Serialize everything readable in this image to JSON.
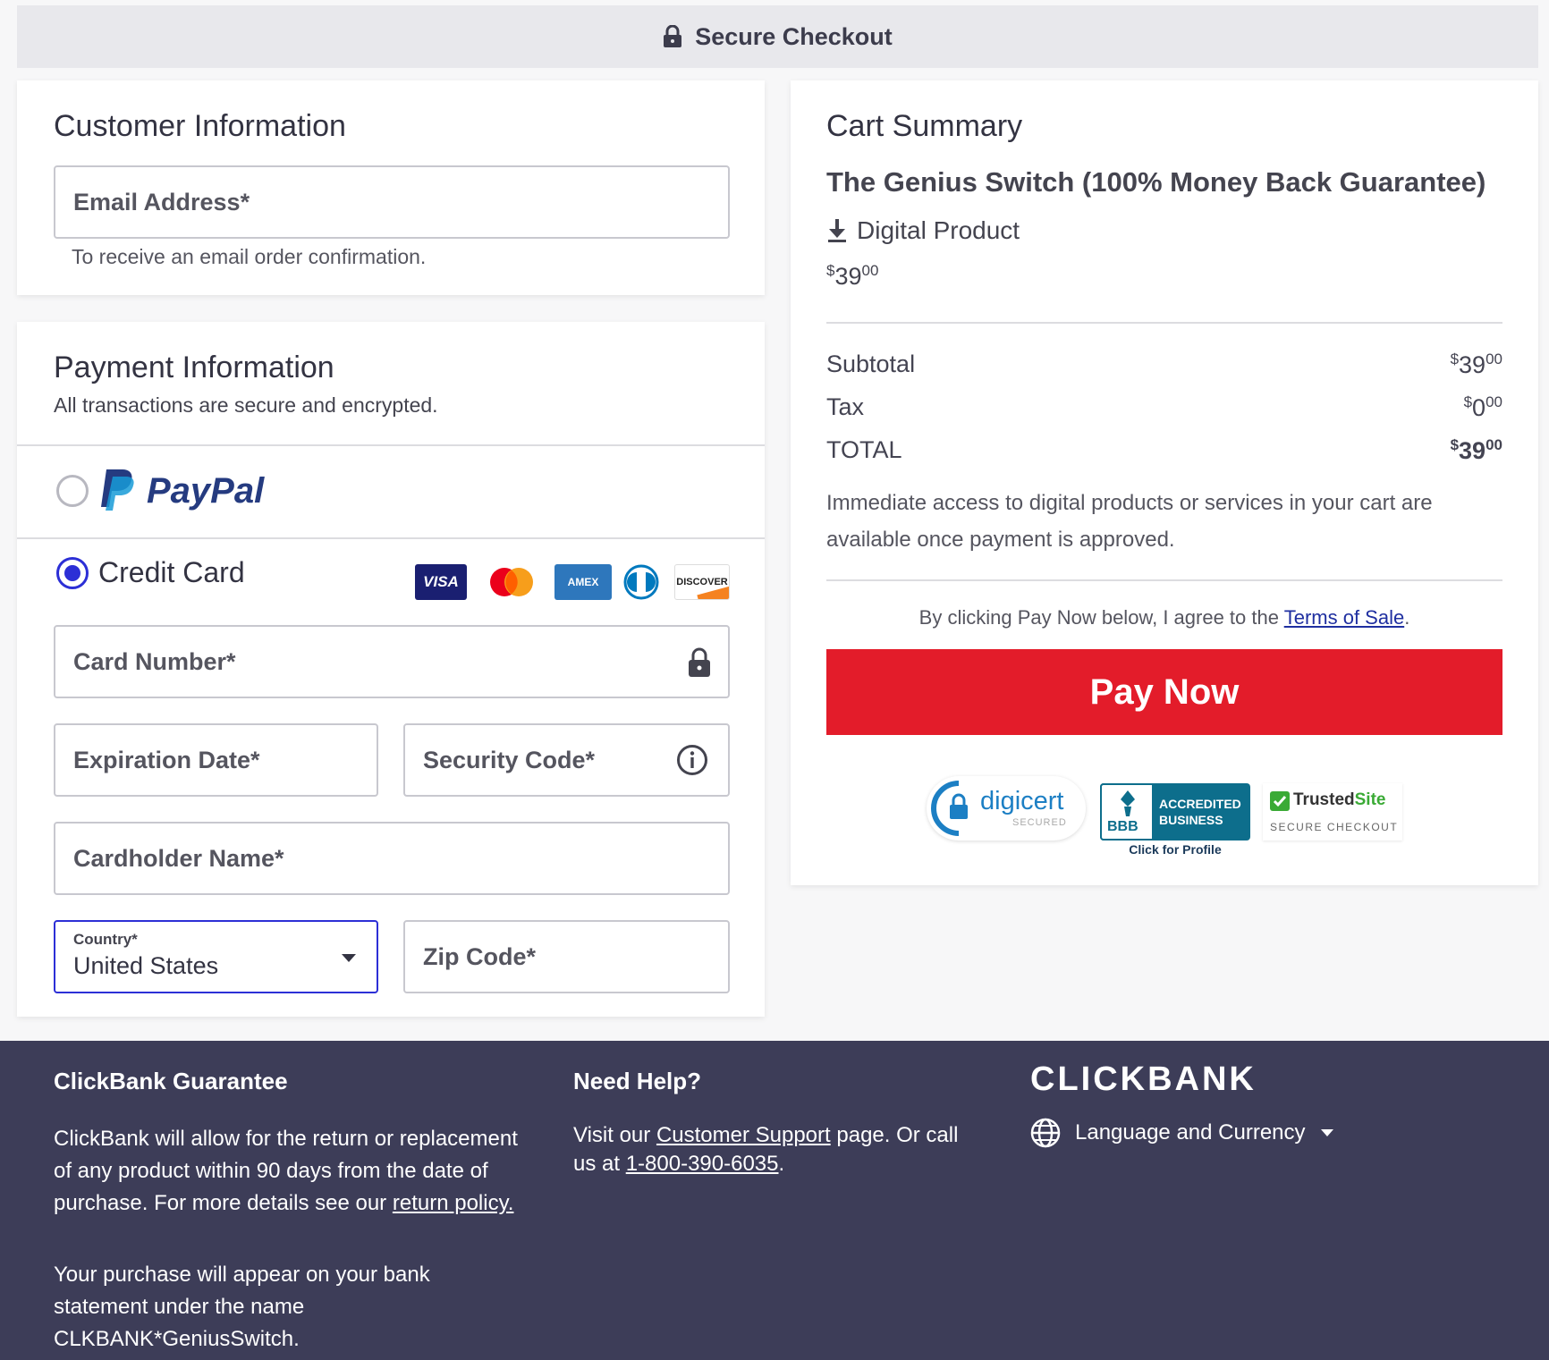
{
  "header": {
    "title": "Secure Checkout"
  },
  "customer": {
    "title": "Customer Information",
    "email_placeholder": "Email Address*",
    "email_hint": "To receive an email order confirmation."
  },
  "payment": {
    "title": "Payment Information",
    "subtitle": "All transactions are secure and encrypted.",
    "paypal_label": "PayPal",
    "credit_card_label": "Credit Card",
    "card_logos": [
      "VISA",
      "Mastercard",
      "AMEX",
      "Diners Club",
      "DISCOVER"
    ],
    "card_number_placeholder": "Card Number*",
    "expiration_placeholder": "Expiration Date*",
    "security_code_placeholder": "Security Code*",
    "cardholder_placeholder": "Cardholder Name*",
    "country_label": "Country*",
    "country_value": "United States",
    "zip_placeholder": "Zip Code*",
    "selected_method": "Credit Card"
  },
  "cart": {
    "title": "Cart Summary",
    "product_name": "The Genius Switch (100% Money Back Guarantee)",
    "product_type": "Digital Product",
    "product_price_dollars": "39",
    "product_price_cents": "00",
    "subtotal_label": "Subtotal",
    "subtotal_dollars": "39",
    "subtotal_cents": "00",
    "tax_label": "Tax",
    "tax_dollars": "0",
    "tax_cents": "00",
    "total_label": "TOTAL",
    "total_dollars": "39",
    "total_cents": "00",
    "currency_symbol": "$",
    "access_note": "Immediate access to digital products or services in your cart are available once payment is approved.",
    "terms_prefix": "By clicking Pay Now below, I agree to the",
    "terms_link": "Terms of Sale",
    "terms_suffix": ".",
    "pay_button": "Pay Now",
    "badges": {
      "digicert": "digicert",
      "digicert_sub": "SECURED",
      "bbb_line1": "ACCREDITED",
      "bbb_line2": "BUSINESS",
      "bbb_logo": "BBB",
      "bbb_caption": "Click for Profile",
      "trusted_main": "Trusted",
      "trusted_site": "Site",
      "trusted_sub": "SECURE CHECKOUT"
    }
  },
  "footer": {
    "guarantee_title": "ClickBank Guarantee",
    "guarantee_text": "ClickBank will allow for the return or replacement of any product within 90 days from the date of purchase. For more details see our",
    "return_policy_link": "return policy.",
    "statement_text": "Your purchase will appear on your bank statement under the name CLKBANK*GeniusSwitch.",
    "help_title": "Need Help?",
    "help_prefix": "Visit our",
    "support_link": "Customer Support",
    "help_middle": "page. Or call us at",
    "phone_link": "1-800-390-6035",
    "help_suffix": ".",
    "brand": "CLICKBANK",
    "language_label": "Language and Currency"
  },
  "colors": {
    "accent_blue": "#2c2fd6",
    "pay_red": "#e31c2a",
    "footer_bg": "#3d3d58",
    "paypal_dark": "#253b80",
    "paypal_light": "#179bd7"
  }
}
